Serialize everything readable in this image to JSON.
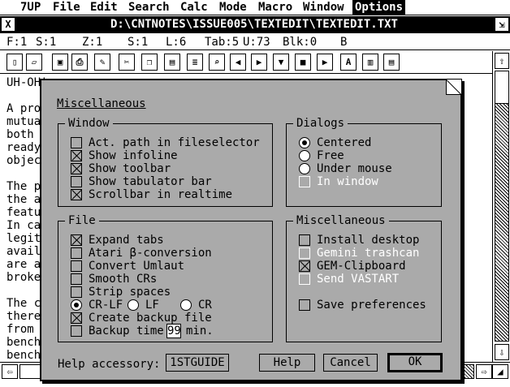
{
  "menubar": {
    "items": [
      "7UP",
      "File",
      "Edit",
      "Search",
      "Calc",
      "Mode",
      "Macro",
      "Window",
      "Options"
    ],
    "active": "Options"
  },
  "window": {
    "title": "D:\\CNTNOTES\\ISSUE005\\TEXTEDIT\\TEXTEDIT.TXT",
    "close_glyph": "X",
    "full_glyph": "⇲"
  },
  "infoline": {
    "font": "F:1",
    "size": "S:1",
    "zoom": "Z:1",
    "spacing": "S:1",
    "line": "L:6",
    "tab": "Tab:5",
    "u": "U:73",
    "block": "Blk:0",
    "mode": "B"
  },
  "toolbar": {
    "icons": [
      "new-file-icon",
      "open-file-icon",
      "save-icon",
      "print-icon",
      "edit-icon",
      "cut-icon",
      "copy-icon",
      "paste-icon",
      "format-icon",
      "find-icon",
      "left-arrow-icon",
      "right-arrow-icon",
      "down-icon",
      "stop-icon",
      "play-icon",
      "font-icon",
      "panels-icon",
      "list-icon"
    ]
  },
  "text": {
    "lines": [
      "UH-OH!",
      "",
      "A pro",
      "mutua",
      "both",
      "ready",
      "objec",
      "",
      "The p",
      "the a",
      "featu",
      "In ca",
      "legit",
      "avail",
      "are a",
      "broke",
      "",
      "The c",
      "there",
      "from",
      "bench",
      "bench"
    ]
  },
  "dialog": {
    "title": "Miscellaneous",
    "window_group": {
      "title": "Window",
      "options": [
        {
          "label": "Act. path in fileselector",
          "checked": false
        },
        {
          "label": "Show infoline",
          "checked": true
        },
        {
          "label": "Show toolbar",
          "checked": true
        },
        {
          "label": "Show tabulator bar",
          "checked": false
        },
        {
          "label": "Scrollbar in realtime",
          "checked": true
        }
      ]
    },
    "dialogs_group": {
      "title": "Dialogs",
      "options": [
        {
          "label": "Centered",
          "selected": true
        },
        {
          "label": "Free",
          "selected": false
        },
        {
          "label": "Under mouse",
          "selected": false
        }
      ],
      "in_window": {
        "label": "In window",
        "checked": false,
        "disabled": true
      }
    },
    "file_group": {
      "title": "File",
      "options": [
        {
          "label": "Expand tabs",
          "checked": true
        },
        {
          "label": "Atari β-conversion",
          "checked": false
        },
        {
          "label": "Convert Umlaut",
          "checked": false
        },
        {
          "label": "Smooth CRs",
          "checked": false
        },
        {
          "label": "Strip spaces",
          "checked": false
        }
      ],
      "line_endings": [
        {
          "label": "CR-LF",
          "selected": true
        },
        {
          "label": "LF",
          "selected": false
        },
        {
          "label": "CR",
          "selected": false
        }
      ],
      "create_backup": {
        "label": "Create backup file",
        "checked": true
      },
      "backup_time": {
        "label": "Backup time",
        "value": "99",
        "unit": "min.",
        "checked": false
      }
    },
    "misc_group": {
      "title": "Miscellaneous",
      "options": [
        {
          "label": "Install desktop",
          "checked": false,
          "disabled": false
        },
        {
          "label": "Gemini trashcan",
          "checked": false,
          "disabled": true
        },
        {
          "label": "GEM-Clipboard",
          "checked": true,
          "disabled": false
        },
        {
          "label": "Send VASTART",
          "checked": false,
          "disabled": true
        }
      ],
      "save_prefs": {
        "label": "Save preferences",
        "checked": false
      }
    },
    "help_accessory": {
      "label": "Help accessory:",
      "value": "1STGUIDE"
    },
    "buttons": {
      "help": "Help",
      "cancel": "Cancel",
      "ok": "OK"
    }
  }
}
